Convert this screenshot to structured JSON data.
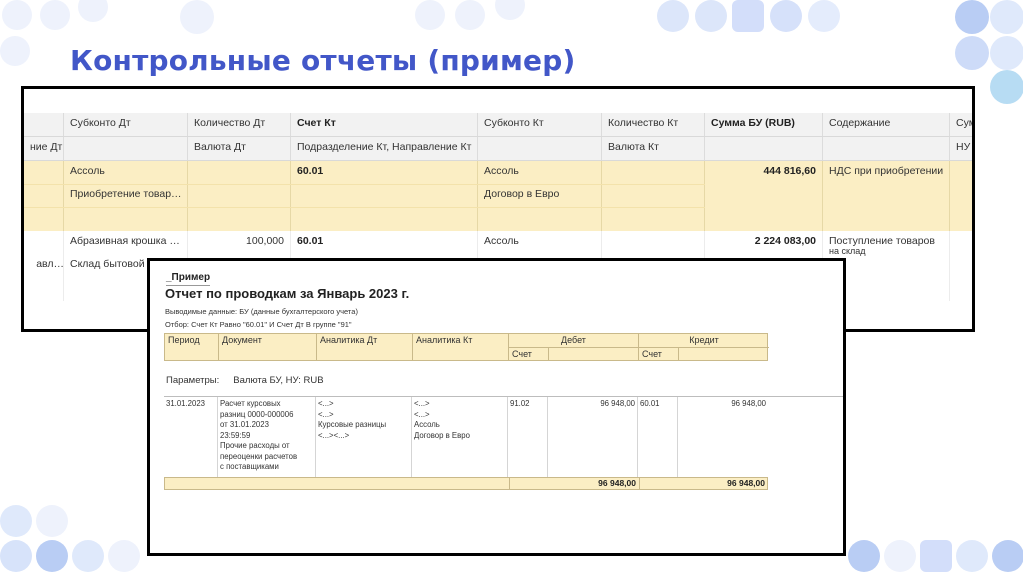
{
  "title": "Контрольные отчеты (пример)",
  "journal": {
    "headers_row1": [
      "",
      "Субконто Дт",
      "Количество Дт",
      "Счет Кт",
      "Субконто Кт",
      "Количество Кт",
      "Сумма БУ (RUB)",
      "Содержание",
      "Сум"
    ],
    "headers_row2": [
      "ние Дт",
      "",
      "Валюта Дт",
      "Подразделение Кт, Направление Кт",
      "",
      "Валюта Кт",
      "",
      "",
      "НУ"
    ],
    "row1": {
      "subkonto_dt": "Ассоль",
      "schet_kt": "60.01",
      "subkonto_kt": "Ассоль",
      "summa": "444 816,60",
      "content": "НДС при приобретении",
      "subkonto_dt_2": "Приобретение товар…",
      "subkonto_kt_2": "Договор в Евро"
    },
    "row2": {
      "subkonto_dt": "Абразивная крошка …",
      "qty_dt": "100,000",
      "schet_kt": "60.01",
      "subkonto_kt": "Ассоль",
      "summa": "2 224 083,00",
      "content": "Поступление товаров",
      "content_2": "на склад",
      "left_2": "авл…",
      "subkonto_dt_2": "Склад бытовой т"
    }
  },
  "report": {
    "tag": "_Пример",
    "title": "Отчет по проводкам за Январь 2023 г.",
    "meta1": "Выводимые данные: БУ (данные бухгалтерского учета)",
    "meta2": "Отбор: Счет Кт Равно \"60.01\" И Счет Дт В группе \"91\"",
    "headers": {
      "period": "Период",
      "document": "Документ",
      "analytics_dt": "Аналитика Дт",
      "analytics_kt": "Аналитика Кт",
      "debit": "Дебет",
      "credit": "Кредит",
      "account_dt": "Счет",
      "account_kt": "Счет"
    },
    "params_label": "Параметры:",
    "params_value": "Валюта БУ, НУ: RUB",
    "row": {
      "period": "31.01.2023",
      "document": [
        "Расчет курсовых",
        "разниц 0000-000006",
        "от 31.01.2023",
        "23:59:59",
        "Прочие расходы от",
        "переоценки расчетов",
        "с поставщиками"
      ],
      "analytics_dt": [
        "<...>",
        "<...>",
        "Курсовые разницы",
        "<...><...>"
      ],
      "analytics_kt": [
        "<...>",
        "<...>",
        "Ассоль",
        "Договор в Евро"
      ],
      "account_dt": "91.02",
      "debit": "96 948,00",
      "account_kt": "60.01",
      "credit": "96 948,00"
    },
    "total_debit": "96 948,00",
    "total_credit": "96 948,00"
  },
  "colors": {
    "title": "#4257c8",
    "highlight": "#fbeec4",
    "deco_light": "#dfe9fb",
    "deco_mid": "#b9cdf4"
  }
}
